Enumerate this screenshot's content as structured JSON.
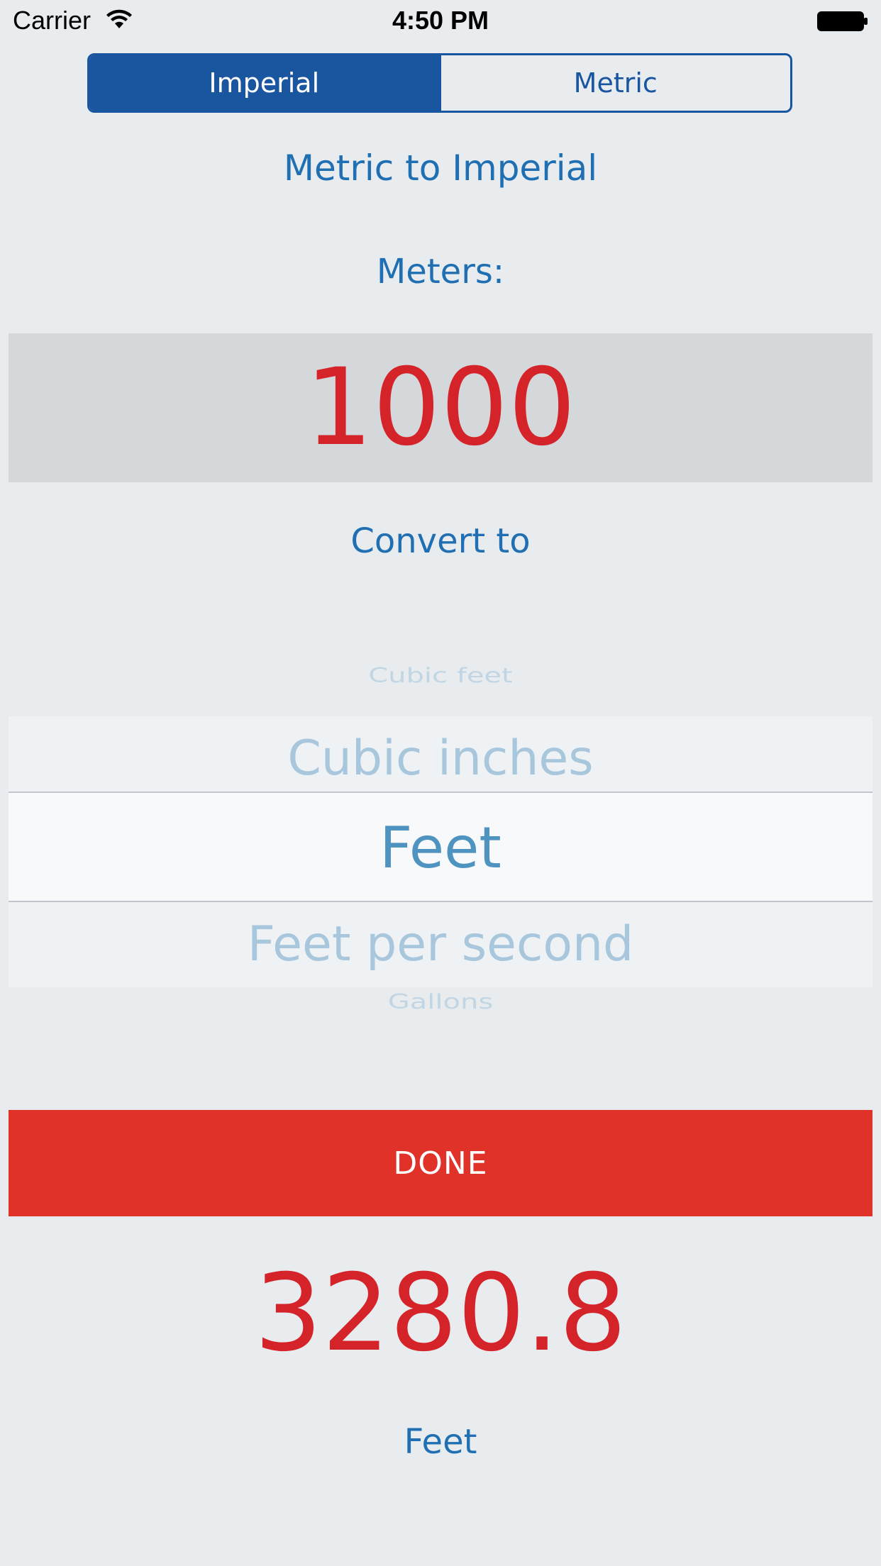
{
  "status_bar": {
    "carrier": "Carrier",
    "time": "4:50 PM"
  },
  "segmented_control": {
    "segments": [
      {
        "label": "Imperial",
        "selected": true
      },
      {
        "label": "Metric",
        "selected": false
      }
    ]
  },
  "title": "Metric to Imperial",
  "input": {
    "label": "Meters:",
    "value": "1000"
  },
  "convert_label": "Convert to",
  "picker": {
    "options": [
      "Cubic feet",
      "Cubic inches",
      "Feet",
      "Feet per second",
      "Gallons"
    ],
    "selected": "Feet"
  },
  "done_button": "DONE",
  "result": {
    "value": "3280.8",
    "unit": "Feet"
  },
  "colors": {
    "accent_blue": "#1a55a0",
    "label_blue": "#1f6fb2",
    "value_red": "#d5232a",
    "button_red": "#e03228"
  }
}
